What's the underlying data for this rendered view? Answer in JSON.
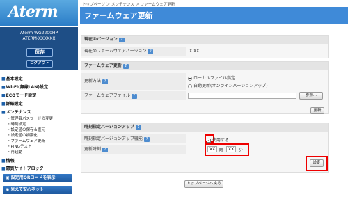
{
  "app": {
    "logo": "Aterm",
    "model": "Aterm  WG2200HP",
    "id": "ATERM-XXXXXX",
    "save": "保存",
    "logout": "ログアウト"
  },
  "nav": [
    {
      "label": "基本設定"
    },
    {
      "label": "Wi-Fi(無線LAN)設定"
    },
    {
      "label": "ECOモード設定"
    },
    {
      "label": "詳細設定"
    },
    {
      "label": "メンテナンス"
    }
  ],
  "maint_sub": [
    "管理者パスワードの変更",
    "時刻設定",
    "設定値の保存＆復元",
    "設定値の初期化",
    "ファームウェア更新",
    "PINGテスト",
    "再起動"
  ],
  "nav2": [
    {
      "label": "情報"
    },
    {
      "label": "悪質サイトブロック"
    }
  ],
  "side_buttons": {
    "qr": "設定用QRコードを表示",
    "mite": "見えて安心ネット"
  },
  "breadcrumb": "トップページ ＞ メンテナンス ＞ ファームウェア更新",
  "page_title": "ファームウェア更新",
  "current": {
    "header": "現在のバージョン",
    "label": "現在のファームウェアバージョン",
    "value": "X.XX"
  },
  "update": {
    "header": "ファームウェア更新",
    "method_label": "更新方法",
    "opt_local": "ローカルファイル指定",
    "opt_auto": "自動更新(オンラインバージョンアップ)",
    "file_label": "ファームウェアファイル",
    "browse": "参照...",
    "update_btn": "更新"
  },
  "scheduled": {
    "header": "時刻指定バージョンアップ",
    "feature_label": "時刻指定バージョンアップ機能",
    "use_label": "使用する",
    "time_label": "更新時刻",
    "hour": "XX",
    "hour_unit": "時",
    "min": "XX",
    "min_unit": "分",
    "set_btn": "設定"
  },
  "top_btn": "トップページへ戻る",
  "help_mark": "?"
}
